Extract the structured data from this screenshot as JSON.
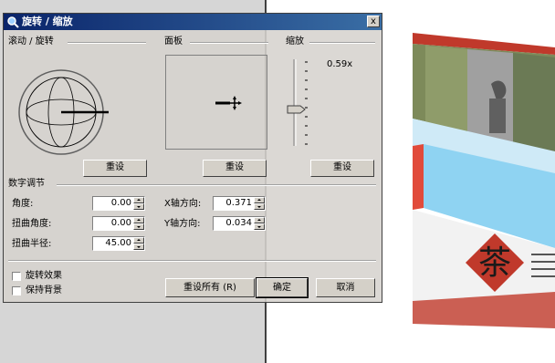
{
  "dialog": {
    "title": "旋转 / 缩放",
    "close_label": "x",
    "groups": {
      "rotate": "滚动 / 旋转",
      "panel": "面板",
      "scale": "缩放",
      "numeric": "数字调节"
    },
    "scale_value": "0.59x",
    "reset_label": "重设",
    "fields": {
      "angle_label": "角度:",
      "angle_value": "0.00",
      "distort_angle_label": "扭曲角度:",
      "distort_angle_value": "0.00",
      "distort_radius_label": "扭曲半径:",
      "distort_radius_value": "45.00",
      "x_dir_label": "X轴方向:",
      "x_dir_value": "0.371",
      "y_dir_label": "Y轴方向:",
      "y_dir_value": "0.034"
    },
    "checkboxes": {
      "swirl_label": "旋转效果",
      "keep_bg_label": "保持背景"
    },
    "buttons": {
      "reset_all": "重设所有 (R)",
      "ok": "确定",
      "cancel": "取消"
    }
  },
  "poster": {
    "character": "茶"
  }
}
